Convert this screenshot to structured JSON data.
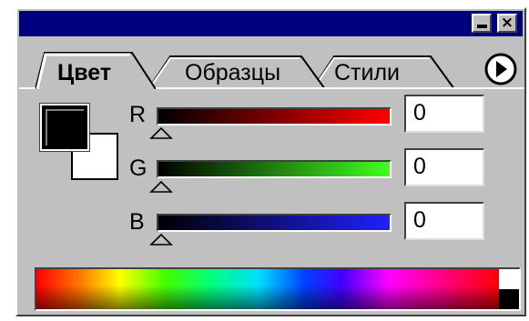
{
  "panel": {
    "title_buttons": {
      "minimize_glyph": "minimize-icon",
      "close_glyph": "×"
    },
    "tabs": [
      {
        "label": "Цвет",
        "active": true
      },
      {
        "label": "Образцы",
        "active": false
      },
      {
        "label": "Стили",
        "active": false
      }
    ],
    "menu_icon": "right-arrow-menu-icon"
  },
  "color": {
    "foreground": "#000000",
    "background": "#ffffff",
    "channels": [
      {
        "label": "R",
        "value": "0",
        "gradient_end": "#ff0000"
      },
      {
        "label": "G",
        "value": "0",
        "gradient_end": "#40ff20"
      },
      {
        "label": "B",
        "value": "0",
        "gradient_end": "#2020ff"
      }
    ]
  }
}
